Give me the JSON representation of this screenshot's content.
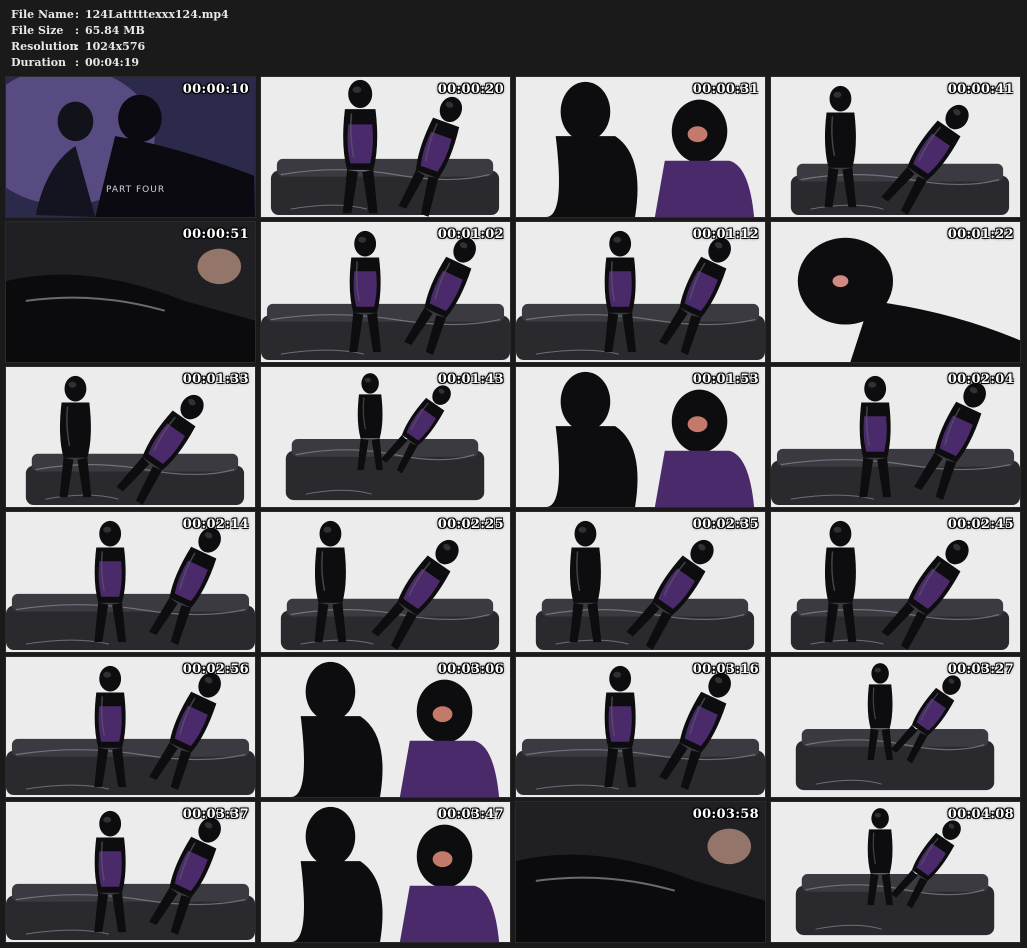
{
  "meta": {
    "file_name_label": "File Name",
    "file_name_value": "124Latttttexxx124.mp4",
    "file_size_label": "File Size",
    "file_size_value": "65.84 MB",
    "resolution_label": "Resolution",
    "resolution_value": "1024x576",
    "duration_label": "Duration",
    "duration_value": "00:04:19",
    "separator": ":"
  },
  "thumbnails": [
    {
      "timestamp": "00:00:10",
      "overlay": "PART FOUR",
      "theme": "purple"
    },
    {
      "timestamp": "00:00:20",
      "theme": "light"
    },
    {
      "timestamp": "00:00:31",
      "theme": "light"
    },
    {
      "timestamp": "00:00:41",
      "theme": "light"
    },
    {
      "timestamp": "00:00:51",
      "theme": "dark"
    },
    {
      "timestamp": "00:01:02",
      "theme": "light"
    },
    {
      "timestamp": "00:01:12",
      "theme": "light"
    },
    {
      "timestamp": "00:01:22",
      "theme": "light"
    },
    {
      "timestamp": "00:01:33",
      "theme": "light"
    },
    {
      "timestamp": "00:01:43",
      "theme": "light"
    },
    {
      "timestamp": "00:01:53",
      "theme": "light"
    },
    {
      "timestamp": "00:02:04",
      "theme": "light"
    },
    {
      "timestamp": "00:02:14",
      "theme": "light"
    },
    {
      "timestamp": "00:02:25",
      "theme": "light"
    },
    {
      "timestamp": "00:02:35",
      "theme": "light"
    },
    {
      "timestamp": "00:02:45",
      "theme": "light"
    },
    {
      "timestamp": "00:02:56",
      "theme": "light"
    },
    {
      "timestamp": "00:03:06",
      "theme": "light"
    },
    {
      "timestamp": "00:03:16",
      "theme": "light"
    },
    {
      "timestamp": "00:03:27",
      "theme": "light"
    },
    {
      "timestamp": "00:03:37",
      "theme": "light"
    },
    {
      "timestamp": "00:03:47",
      "theme": "light"
    },
    {
      "timestamp": "00:03:58",
      "theme": "dark"
    },
    {
      "timestamp": "00:04:08",
      "theme": "light"
    }
  ],
  "colors": {
    "background": "#1a1a1a",
    "meta_text": "#e8e8e8",
    "latex_black": "#0d0d0f",
    "latex_purple": "#4a2a6a",
    "studio_white": "#ececec",
    "couch_dark": "#2a2a2e",
    "purple_bg": "#6a5a9a"
  }
}
